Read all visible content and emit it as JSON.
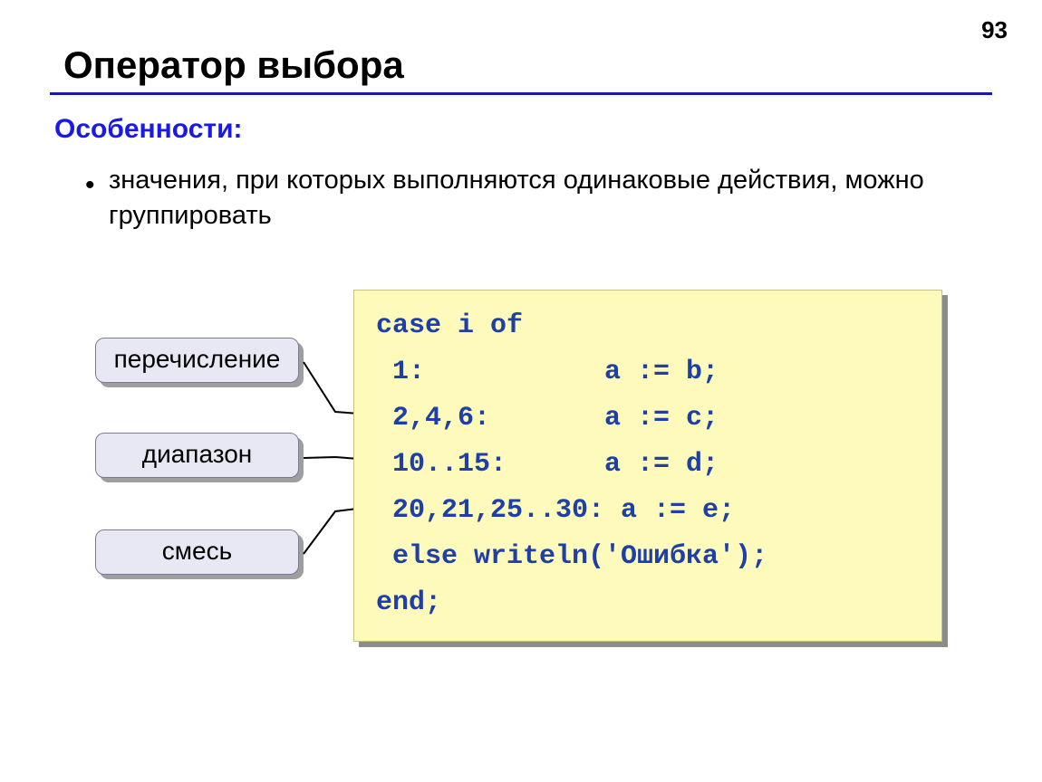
{
  "slide": {
    "number": "93",
    "title": "Оператор выбора",
    "subheading": "Особенности:",
    "bullet": "значения, при которых выполняются одинаковые действия, можно группировать"
  },
  "callouts": {
    "enum": "перечисление",
    "range": "диапазон",
    "mixed": "смесь"
  },
  "code": "case i of\n 1:           a := b;\n 2,4,6:       a := c;\n 10..15:      a := d;\n 20,21,25..30: a := e;\n else writeln('Ошибка');\nend;"
}
